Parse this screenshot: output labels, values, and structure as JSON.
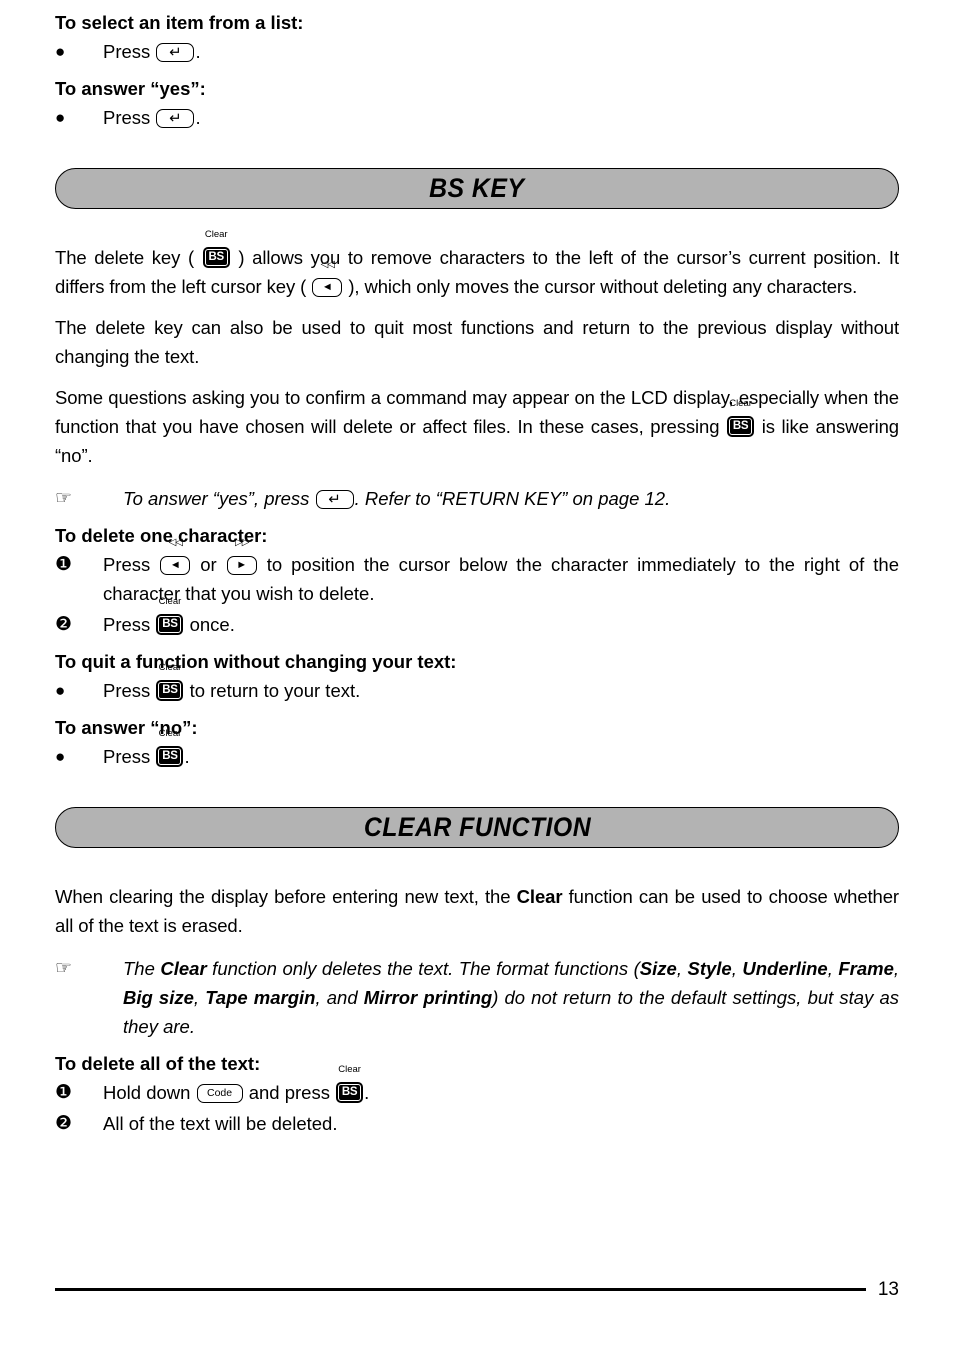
{
  "page": {
    "number": "13"
  },
  "intro": {
    "heading_select": "To select an item from a list:",
    "press_label_1": "Press",
    "period_1": ".",
    "heading_yes": "To answer “yes”:",
    "press_label_2": "Press",
    "period_2": "."
  },
  "sections": [
    {
      "title": "BS KEY",
      "paragraphs": [
        {
          "parts": [
            "The delete key ( ",
            "[BS-KEY]",
            " ) allows you to remove characters to the left of the cursor’s current position. It differs from the left cursor key ( ",
            "[LEFT-CURSOR-KEY]",
            " ), which only moves the cursor without deleting any characters."
          ]
        },
        {
          "text": "The delete key can also be used to quit most functions and return to the previous display without changing the text."
        },
        {
          "parts": [
            "Some questions asking you to confirm a command may appear on the LCD display, especially when the function that you have chosen will delete or affect files. In these cases, pressing ",
            "[BS-KEY]",
            " is like answering “no”."
          ]
        }
      ],
      "note": {
        "marker": "☞",
        "before_key": "To answer “yes”, press ",
        "after_key": ". Refer to “RETURN KEY” on page 12."
      },
      "procedures": [
        {
          "heading": "To delete one character:",
          "steps": [
            {
              "marker": "❶",
              "t1": "Press ",
              "t2": " or ",
              "t3": " to position the cursor below the character immediately to the right of the character that you wish to delete."
            },
            {
              "marker": "❷",
              "t1": "Press ",
              "t3": " once."
            }
          ]
        },
        {
          "heading": "To quit a function without changing your text:",
          "steps": [
            {
              "marker": "●",
              "t1": "Press ",
              "t3": " to return to your text."
            }
          ]
        },
        {
          "heading": "To answer “no”:",
          "steps": [
            {
              "marker": "●",
              "t1": "Press ",
              "t3": "."
            }
          ]
        }
      ]
    },
    {
      "title": "CLEAR FUNCTION",
      "intro": {
        "p1": "When clearing the display before entering new text, the ",
        "clear_bold": "Clear",
        "p2": " function can be used to choose whether all of the text is erased."
      },
      "note": {
        "marker": "☞",
        "s1": "The ",
        "b1": "Clear",
        "s2": " function only deletes the text. The format functions (",
        "b2": "Size",
        "s3": ", ",
        "b3": "Style",
        "s4": ", ",
        "b4": "Underline",
        "s5": ", ",
        "b5": "Frame",
        "s6": ", ",
        "b6": "Big size",
        "s7": ", ",
        "b7": "Tape margin",
        "s8": ", and ",
        "b8": "Mirror printing",
        "s9": ") do not return to the default settings, but stay as they are."
      },
      "procedure": {
        "heading": "To delete all of the text:",
        "steps": [
          {
            "marker": "❶",
            "t1": "Hold down ",
            "t2": " and press ",
            "t3": "."
          },
          {
            "marker": "❷",
            "t1": "All of the text will be deleted."
          }
        ]
      }
    }
  ],
  "keys": {
    "bs": {
      "face": "BS",
      "top_label": "Clear"
    },
    "left_cursor": {
      "face": "◄",
      "top_label": "◁◁"
    },
    "right_cursor": {
      "face": "►",
      "top_label": "▷▷"
    },
    "return": {
      "face": "↵"
    },
    "code": {
      "face": "Code"
    }
  },
  "colors": {
    "section_bar_fill": "#b3b3b3",
    "ink": "#000000",
    "paper": "#ffffff"
  }
}
